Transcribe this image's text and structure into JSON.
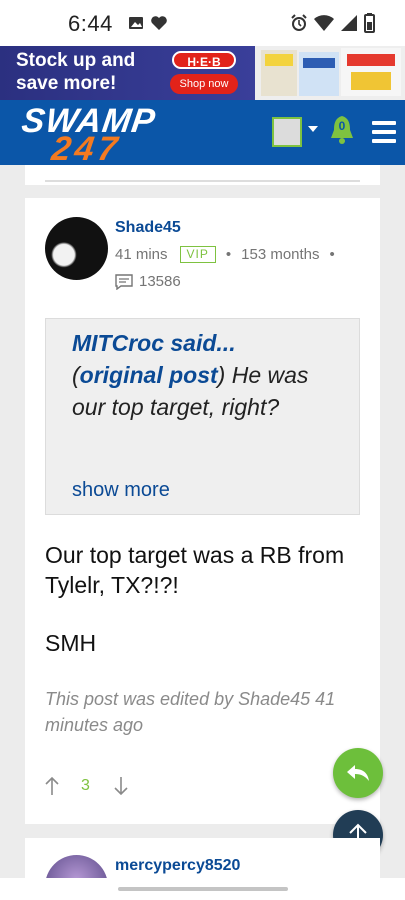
{
  "status_bar": {
    "time": "6:44",
    "left_icons": [
      "image-icon",
      "heart-icon"
    ],
    "right_icons": [
      "alarm-icon",
      "wifi-icon",
      "signal-icon",
      "battery-icon"
    ]
  },
  "ad": {
    "headline": "Stock up and save more!",
    "brand": "H·E·B",
    "cta": "Shop now"
  },
  "header": {
    "logo_top": "SWAMP",
    "logo_bottom": "247",
    "notification_count": "0"
  },
  "post": {
    "username": "Shade45",
    "time_ago": "41 mins",
    "badge": "VIP",
    "membership": "153 months",
    "post_count": "13586",
    "quote": {
      "author_said": "MITCroc said...",
      "open_paren": "(",
      "link_text": "original post",
      "close_paren": ")",
      "text": " He was our top target, right?",
      "show_more": "show more"
    },
    "body": {
      "line1": "Our top target was a RB from Tylelr, TX?!?!",
      "line2": "SMH"
    },
    "edited_note": "This post was edited by Shade45 41 minutes ago",
    "vote_count": "3"
  },
  "next_post": {
    "username": "mercypercy8520"
  },
  "colors": {
    "brand_blue": "#0b56a8",
    "brand_orange": "#f47a20",
    "vip_green": "#7ec240",
    "reply_fab": "#6dbf3b",
    "top_fab": "#213d55"
  }
}
